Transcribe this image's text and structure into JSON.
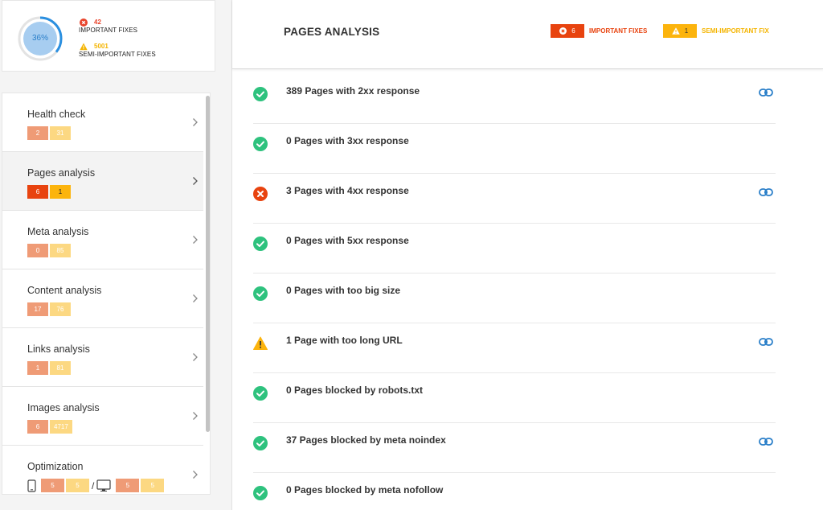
{
  "summary": {
    "score": "36%",
    "score_value": 36,
    "important_count": "42",
    "important_label": "IMPORTANT FIXES",
    "semi_count": "5001",
    "semi_label": "SEMI-IMPORTANT FIXES"
  },
  "sidebar": {
    "items": [
      {
        "label": "Health check",
        "b1": "2",
        "b2": "31"
      },
      {
        "label": "Pages analysis",
        "b1": "6",
        "b2": "1"
      },
      {
        "label": "Meta analysis",
        "b1": "0",
        "b2": "85"
      },
      {
        "label": "Content analysis",
        "b1": "17",
        "b2": "76"
      },
      {
        "label": "Links analysis",
        "b1": "1",
        "b2": "81"
      },
      {
        "label": "Images analysis",
        "b1": "6",
        "b2": "4717"
      },
      {
        "label": "Optimization",
        "mobile_b1": "5",
        "mobile_b2": "5",
        "separator": "/",
        "desktop_b1": "5",
        "desktop_b2": "5"
      }
    ]
  },
  "main": {
    "title": "PAGES ANALYSIS",
    "important_count": "6",
    "important_label": "IMPORTANT FIXES",
    "semi_count": "1",
    "semi_label": "SEMI-IMPORTANT FIX",
    "rows": [
      {
        "status": "ok",
        "text": "389 Pages with 2xx response",
        "link": true
      },
      {
        "status": "ok",
        "text": "0 Pages with 3xx response",
        "link": false
      },
      {
        "status": "error",
        "text": "3 Pages with 4xx response",
        "link": true
      },
      {
        "status": "ok",
        "text": "0 Pages with 5xx response",
        "link": false
      },
      {
        "status": "ok",
        "text": "0 Pages with too big size",
        "link": false
      },
      {
        "status": "warning",
        "text": "1 Page with too long URL",
        "link": true
      },
      {
        "status": "ok",
        "text": "0 Pages blocked by robots.txt",
        "link": false
      },
      {
        "status": "ok",
        "text": "37 Pages blocked by meta noindex",
        "link": true
      },
      {
        "status": "ok",
        "text": "0 Pages blocked by meta nofollow",
        "link": false
      }
    ]
  },
  "colors": {
    "ok": "#2ec27e",
    "error": "#e8430f",
    "warning": "#fcb40d",
    "link": "#2a7fc9",
    "ring": "#2a8fe0",
    "ring_fill": "#a7cdf0"
  },
  "icons": {
    "ok": "check-circle-icon",
    "error": "x-circle-icon",
    "warning": "warning-triangle-icon",
    "link": "link-icon",
    "nav": "chevron-right-icon",
    "mobile": "mobile-icon",
    "desktop": "desktop-icon"
  }
}
